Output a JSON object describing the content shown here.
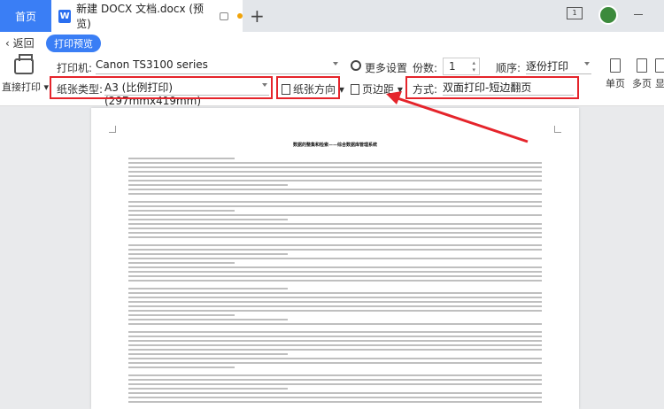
{
  "tabs": {
    "home": "首页",
    "doc_icon": "W",
    "doc_title": "新建 DOCX 文档.docx (预览)",
    "add": "+"
  },
  "window": {
    "page_indicator": "1"
  },
  "nav": {
    "back": "返回",
    "preview": "打印预览"
  },
  "toolbar": {
    "direct_print": "直接打印",
    "printer_label": "打印机:",
    "printer_value": "Canon TS3100 series",
    "more_settings": "更多设置",
    "copies_label": "份数:",
    "copies_value": "1",
    "order_label": "顺序:",
    "order_value": "逐份打印",
    "paper_label": "纸张类型:",
    "paper_value": "A3 (比例打印)(297mmx419mm)",
    "orientation": "纸张方向",
    "margins": "页边距",
    "mode_label": "方式:",
    "mode_value": "双面打印-短边翻页",
    "single_page": "单页",
    "multi_page": "多页",
    "display": "显"
  },
  "document": {
    "title": "数据的整集和检索——综合数据库管理系统"
  },
  "colors": {
    "accent": "#3a7ef5",
    "highlight": "#e5242b"
  }
}
